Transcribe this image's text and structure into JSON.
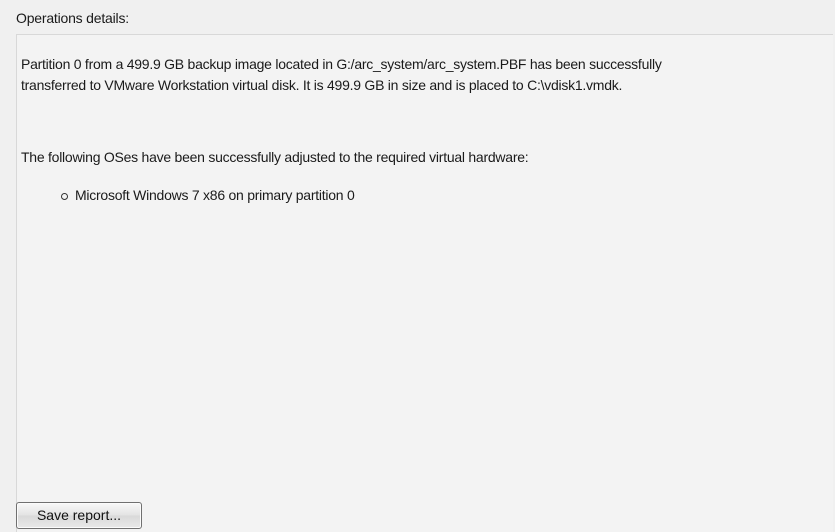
{
  "header": {
    "title": "Operations details:"
  },
  "details": {
    "line1": "Partition 0 from a 499.9 GB backup image located in G:/arc_system/arc_system.PBF has been successfully",
    "line2": "transferred to  VMware Workstation virtual disk. It is 499.9 GB in size and is placed to C:\\vdisk1.vmdk.",
    "os_intro": "The following OSes have been successfully adjusted to the required virtual hardware:",
    "os_list": [
      "Microsoft Windows 7 x86 on primary partition 0"
    ]
  },
  "footer": {
    "save_label": "Save report..."
  }
}
